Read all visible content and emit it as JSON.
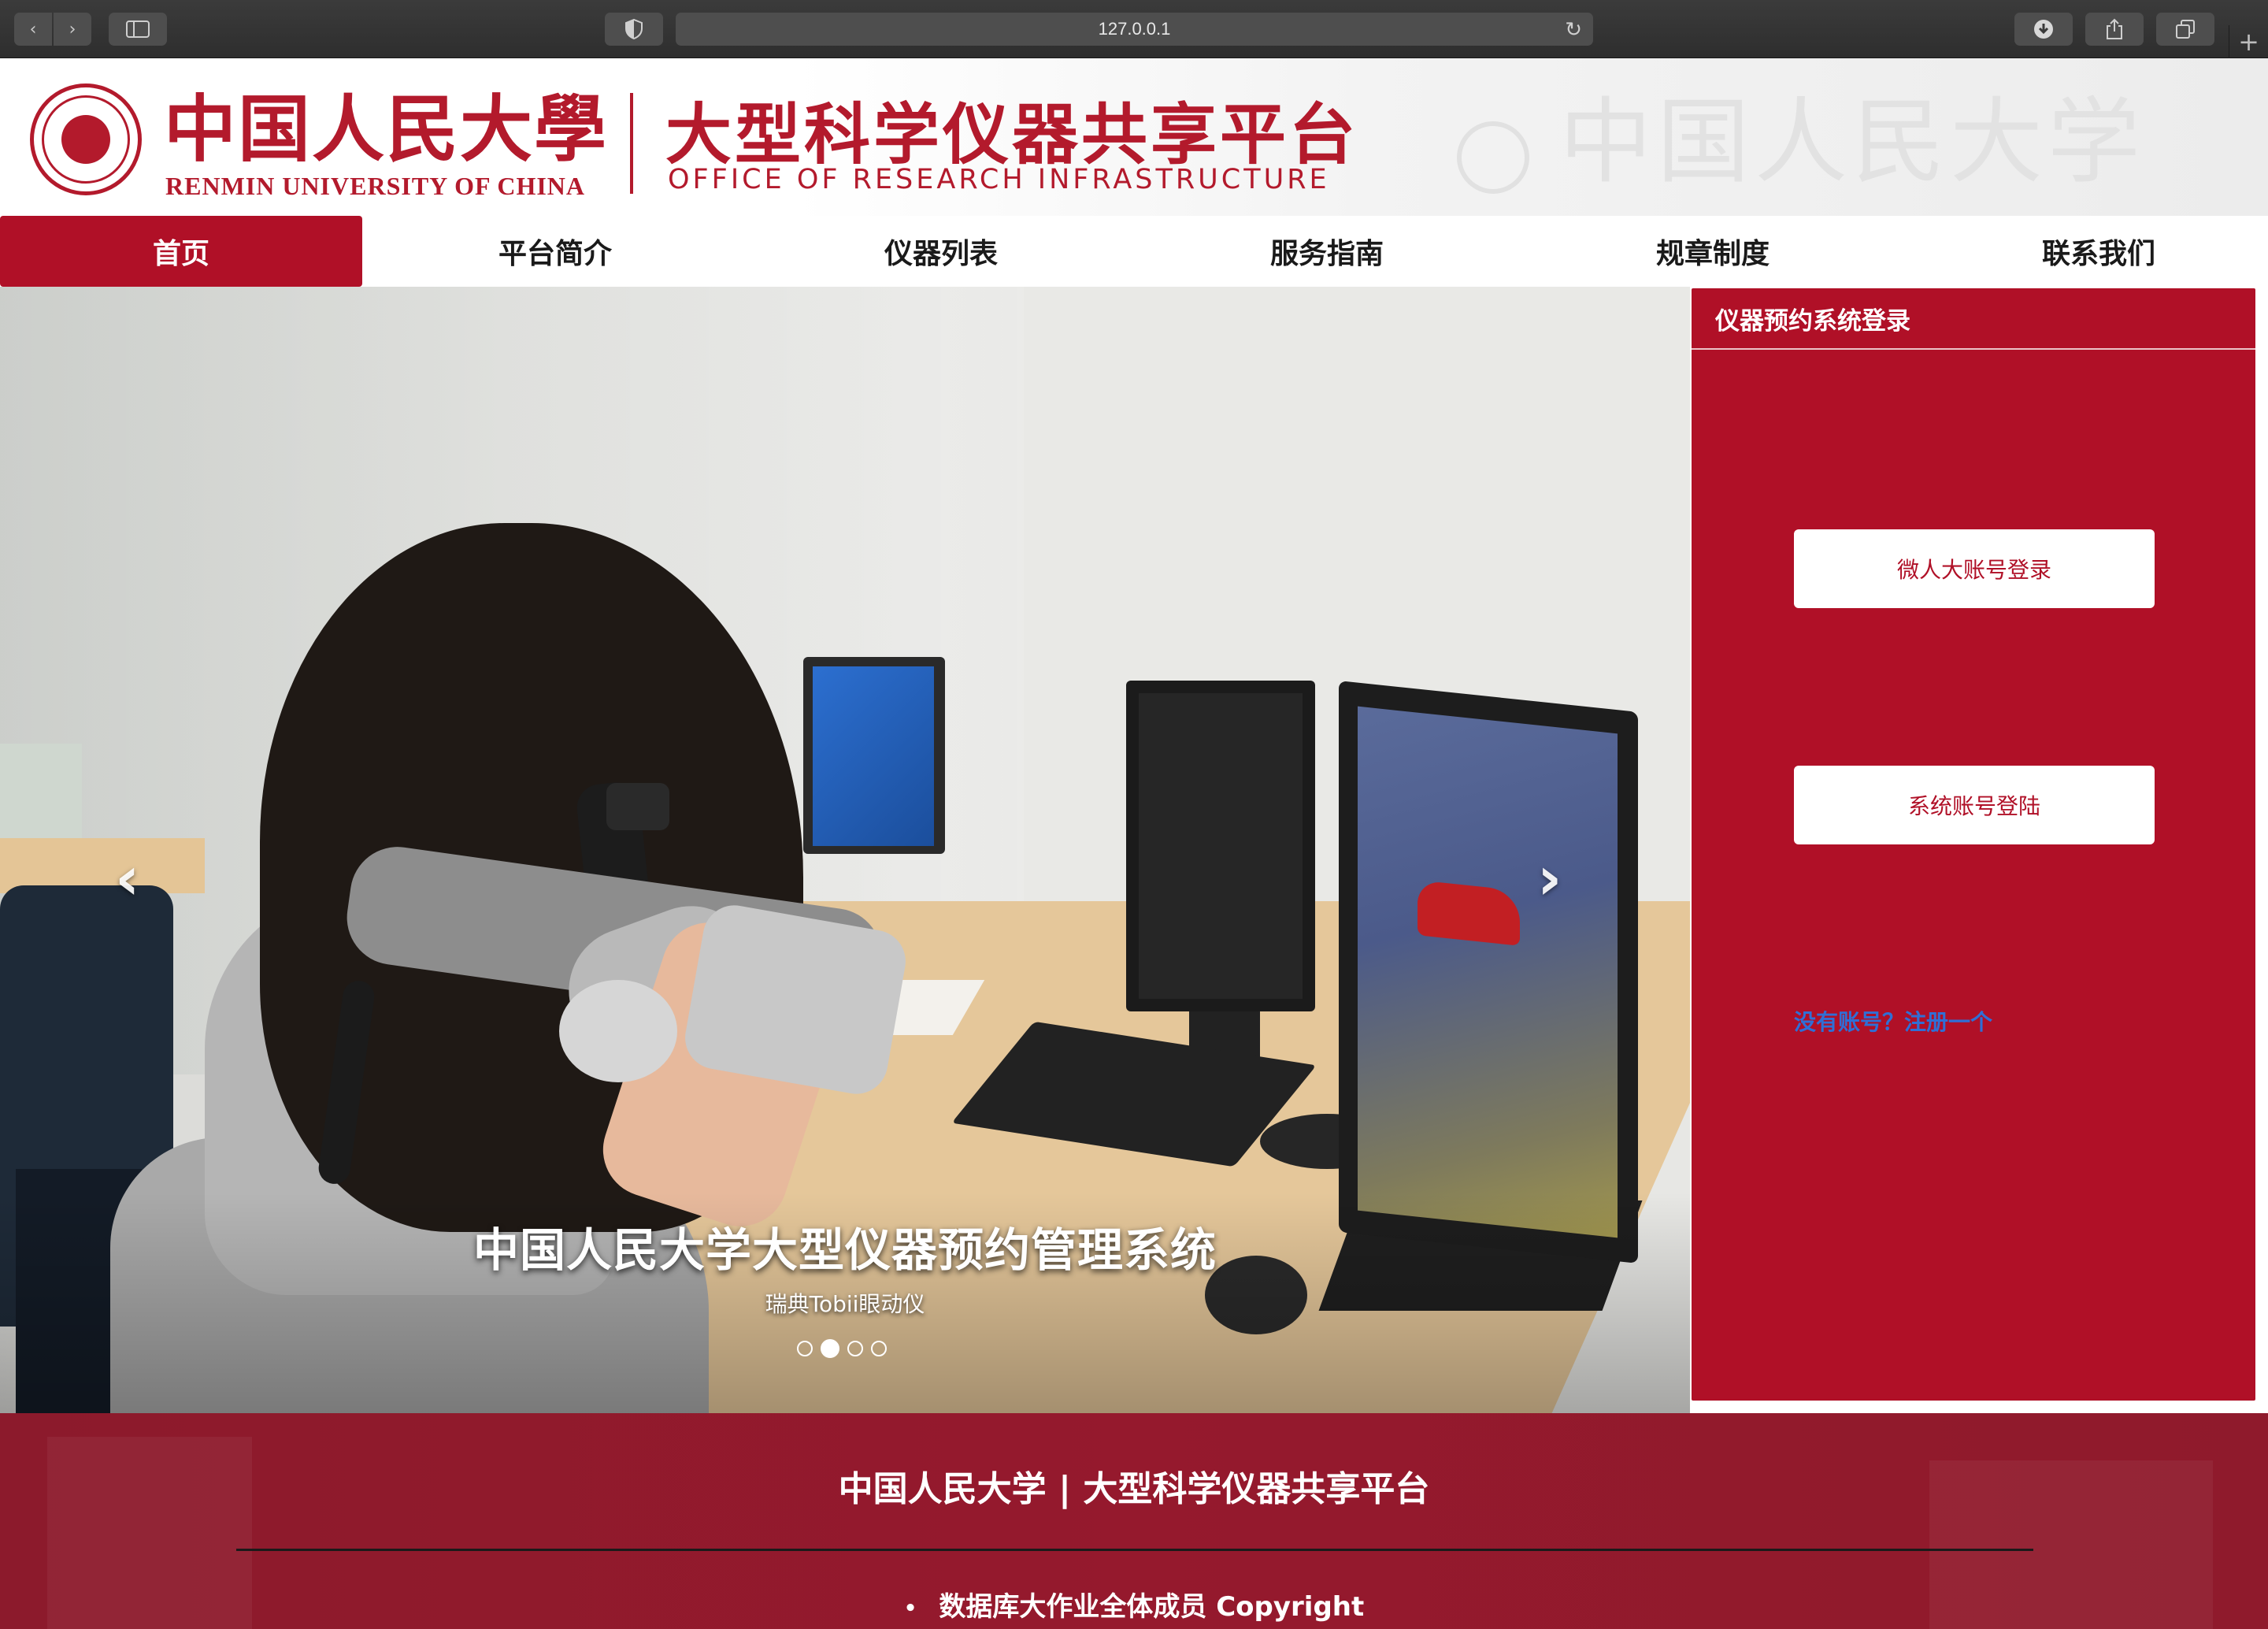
{
  "browser": {
    "url": "127.0.0.1",
    "icons": {
      "back": "chevron-left-icon",
      "forward": "chevron-right-icon",
      "sidebar": "sidebar-icon",
      "privacy": "shield-icon",
      "reload": "reload-icon",
      "download": "download-icon",
      "share": "share-icon",
      "tabs": "tabs-icon",
      "new_tab": "plus-icon"
    }
  },
  "header": {
    "university_cn": "中国人民大學",
    "university_en": "RENMIN UNIVERSITY OF CHINA",
    "platform_cn": "大型科学仪器共享平台",
    "platform_en": "OFFICE OF RESEARCH INFRASTRUCTURE",
    "watermark": "中国人民大学"
  },
  "nav": {
    "items": [
      {
        "label": "首页",
        "active": true
      },
      {
        "label": "平台简介",
        "active": false
      },
      {
        "label": "仪器列表",
        "active": false
      },
      {
        "label": "服务指南",
        "active": false
      },
      {
        "label": "规章制度",
        "active": false
      },
      {
        "label": "联系我们",
        "active": false
      }
    ]
  },
  "carousel": {
    "title": "中国人民大学大型仪器预约管理系统",
    "subtitle": "瑞典Tobii眼动仪",
    "prev_glyph": "‹",
    "next_glyph": "›",
    "slide_count": 4,
    "active_slide": 2
  },
  "login": {
    "title": "仪器预约系统登录",
    "wei_button": "微人大账号登录",
    "system_button": "系统账号登陆",
    "register_link": "没有账号？注册一个"
  },
  "footer": {
    "title": "中国人民大学 | 大型科学仪器共享平台",
    "copyright": "数据库大作业全体成员 Copyright",
    "bullet": "•"
  },
  "colors": {
    "brand_red": "#b01027",
    "logo_red": "#b31a2c",
    "footer_red": "#95192d",
    "link_blue": "#2f6fd6"
  }
}
